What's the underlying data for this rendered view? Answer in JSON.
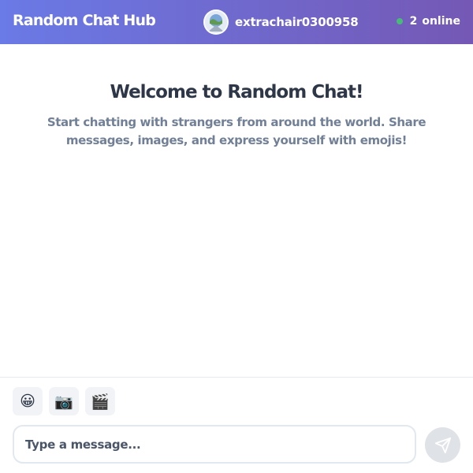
{
  "header": {
    "app_title": "Random Chat Hub",
    "username": "extrachair0300958",
    "online_count": "2",
    "online_label": "online"
  },
  "welcome": {
    "title": "Welcome to Random Chat!",
    "text": "Start chatting with strangers from around the world. Share messages, images, and express yourself with emojis!"
  },
  "toolbar": {
    "emoji_glyph": "😀",
    "image_glyph": "📷",
    "gif_glyph": "🎬"
  },
  "composer": {
    "placeholder": "Type a message...",
    "value": ""
  },
  "colors": {
    "header_start": "#6a7ae6",
    "header_end": "#7558b5",
    "online": "#48bb78"
  },
  "icons": {
    "avatar": "avatar-image",
    "status": "online-dot",
    "send": "send-icon"
  }
}
